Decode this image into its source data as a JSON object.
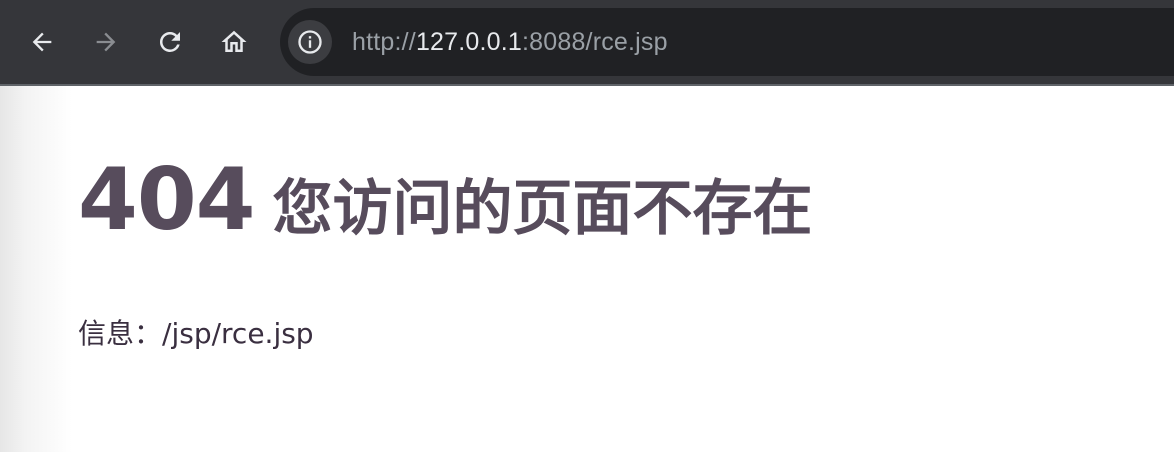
{
  "browser": {
    "toolbar_color": "#35363a",
    "omnibox_color": "#202124",
    "buttons": {
      "back_icon": "arrow-left-icon",
      "forward_icon": "arrow-right-icon",
      "reload_icon": "reload-icon",
      "home_icon": "home-icon",
      "site_info_icon": "info-icon"
    },
    "url": {
      "scheme": "http://",
      "host": "127.0.0.1",
      "rest": ":8088/rce.jsp"
    }
  },
  "page": {
    "error_code": "404",
    "error_message": "您访问的页面不存在",
    "info_label": "信息：",
    "info_value": "/jsp/rce.jsp",
    "text_color": "#574c5c"
  }
}
